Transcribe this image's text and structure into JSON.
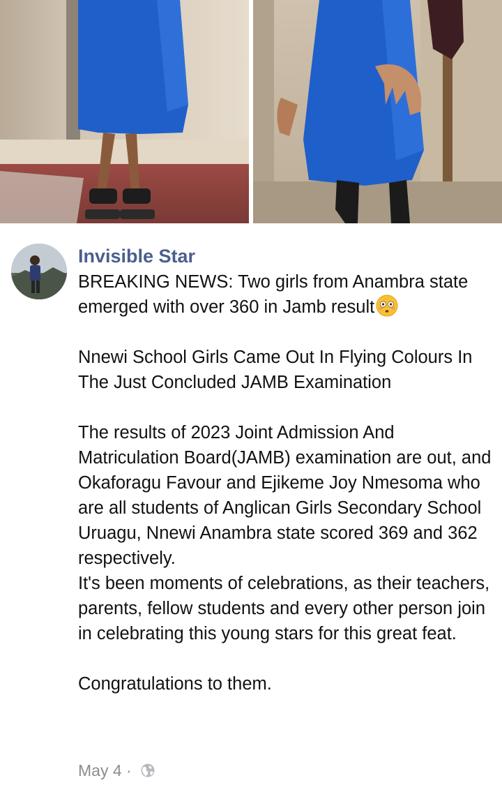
{
  "post": {
    "author": "Invisible Star",
    "paragraphs": [
      "BREAKING NEWS: Two girls from Anambra state emerged with over 360 in Jamb result",
      "Nnewi School Girls Came Out In Flying Colours In The Just Concluded JAMB Examination",
      "The results of 2023 Joint Admission And Matriculation Board(JAMB) examination are out, and Okaforagu Favour and Ejikeme Joy Nmesoma who are all students of Anglican Girls Secondary School Uruagu, Nnewi Anambra state scored 369 and 362 respectively.",
      "It's been moments of celebrations, as their teachers, parents, fellow students and every other person join in celebrating this young stars for this great feat.",
      "Congratulations to them."
    ],
    "emoji": "flushed-face-emoji",
    "date": "May 4",
    "separator": "·",
    "privacy_icon": "globe-icon"
  },
  "colors": {
    "author": "#4b5f8c",
    "meta": "#8a8d91",
    "uniform_blue": "#1f5fc9"
  }
}
